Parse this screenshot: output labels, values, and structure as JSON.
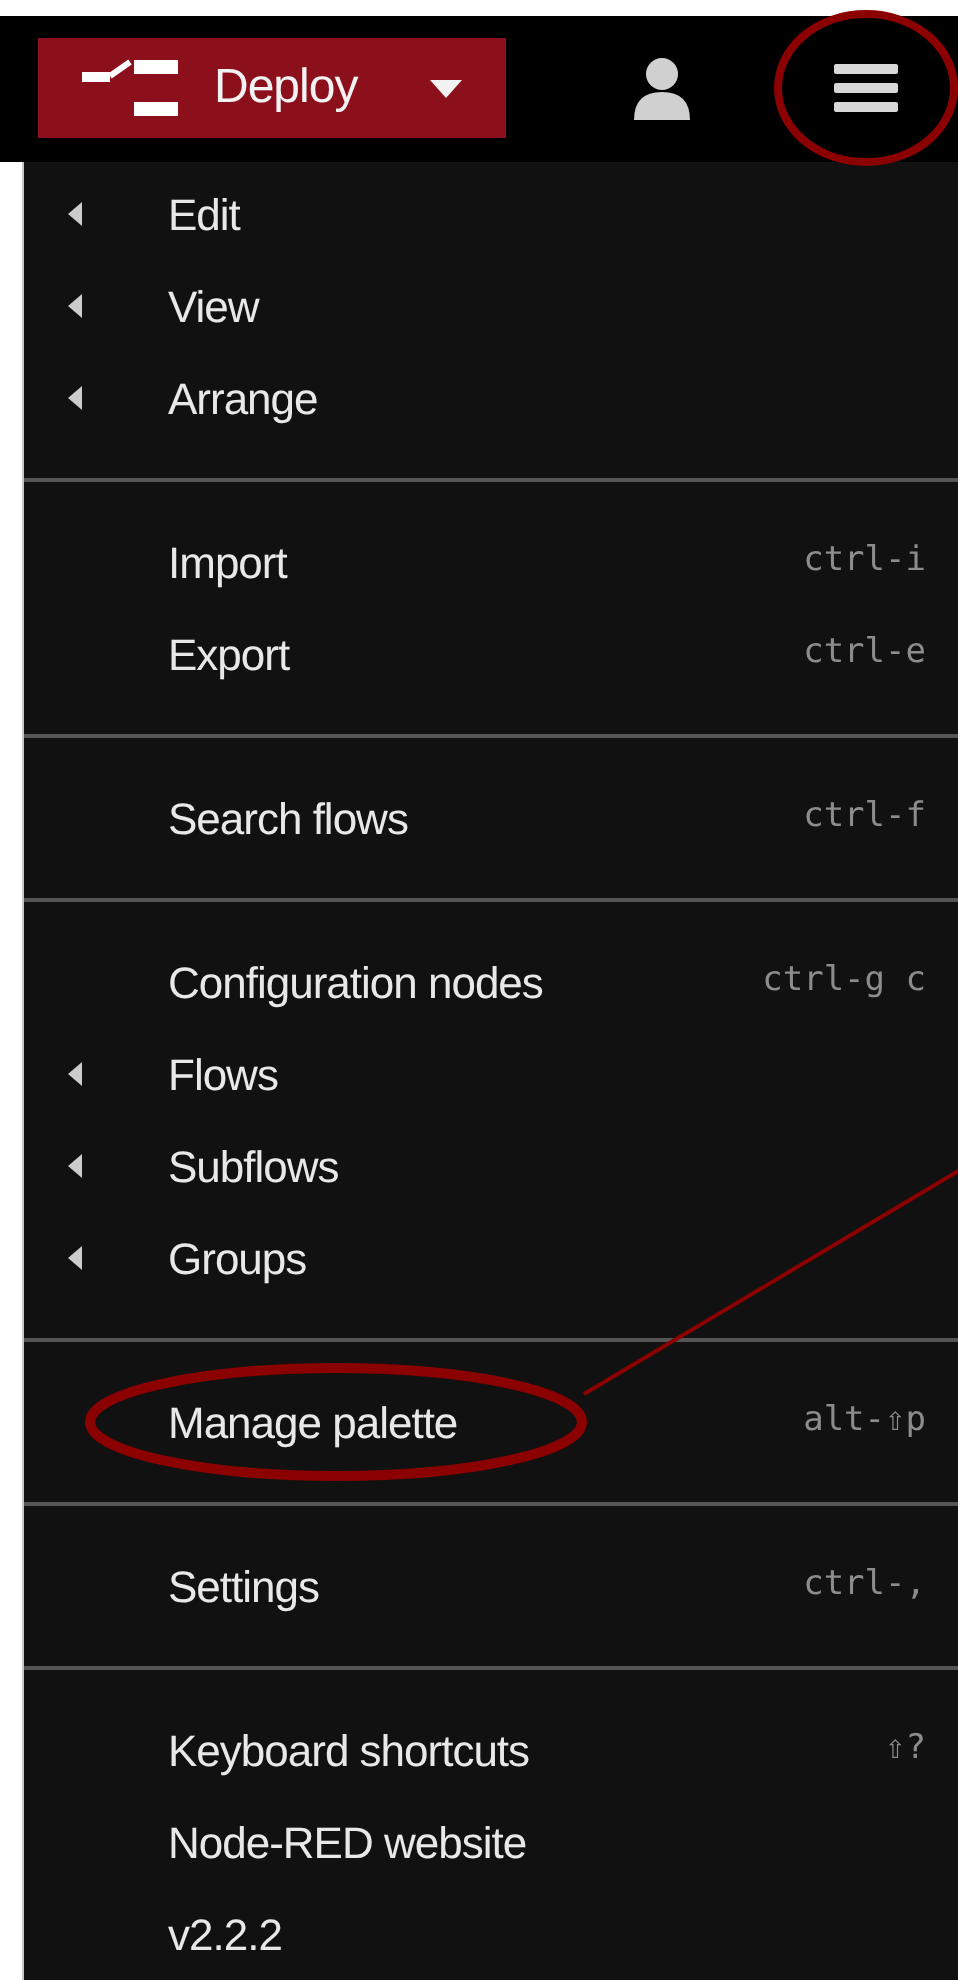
{
  "header": {
    "deploy_label": "Deploy",
    "menu_button_highlighted": true
  },
  "menu_sections": [
    {
      "items": [
        {
          "label": "Edit",
          "submenu": true,
          "highlighted": false
        },
        {
          "label": "View",
          "submenu": true,
          "highlighted": false
        },
        {
          "label": "Arrange",
          "submenu": true,
          "highlighted": false
        }
      ]
    },
    {
      "items": [
        {
          "label": "Import",
          "shortcut": "ctrl-i",
          "submenu": false,
          "highlighted": false
        },
        {
          "label": "Export",
          "shortcut": "ctrl-e",
          "submenu": false,
          "highlighted": false
        }
      ]
    },
    {
      "items": [
        {
          "label": "Search flows",
          "shortcut": "ctrl-f",
          "submenu": false,
          "highlighted": false
        }
      ]
    },
    {
      "items": [
        {
          "label": "Configuration nodes",
          "shortcut": "ctrl-g c",
          "submenu": false,
          "highlighted": false
        },
        {
          "label": "Flows",
          "submenu": true,
          "highlighted": false
        },
        {
          "label": "Subflows",
          "submenu": true,
          "highlighted": false
        },
        {
          "label": "Groups",
          "submenu": true,
          "highlighted": false
        }
      ]
    },
    {
      "items": [
        {
          "label": "Manage palette",
          "shortcut": "alt-⇧p",
          "submenu": false,
          "highlighted": true
        }
      ]
    },
    {
      "items": [
        {
          "label": "Settings",
          "shortcut": "ctrl-,",
          "submenu": false,
          "highlighted": false
        }
      ]
    },
    {
      "items": [
        {
          "label": "Keyboard shortcuts",
          "shortcut": "⇧?",
          "submenu": false,
          "highlighted": false
        },
        {
          "label": "Node-RED website",
          "submenu": false,
          "highlighted": false
        },
        {
          "label": "v2.2.2",
          "submenu": false,
          "highlighted": false
        }
      ]
    }
  ]
}
